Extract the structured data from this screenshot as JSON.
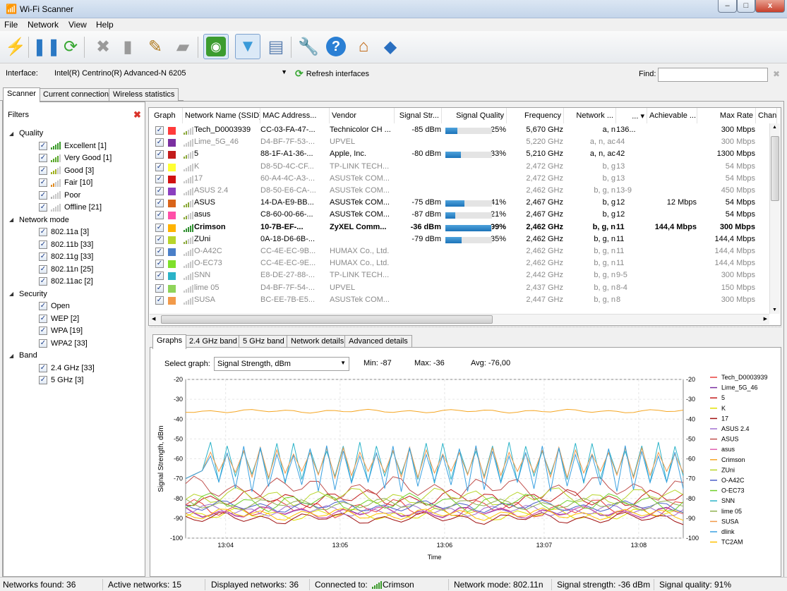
{
  "window": {
    "title": "Wi-Fi Scanner",
    "minimize": "–",
    "maximize": "□",
    "close": "x"
  },
  "menu": [
    "File",
    "Network",
    "View",
    "Help"
  ],
  "toolbar": [
    {
      "name": "start-stop-icon",
      "glyph": "⚡",
      "color": "#e8a400"
    },
    {
      "name": "pause-icon",
      "glyph": "❚❚",
      "color": "#2a78c4"
    },
    {
      "name": "refresh-icon",
      "glyph": "⟳",
      "color": "#3aa835"
    },
    {
      "name": "delete-icon",
      "glyph": "✖",
      "color": "#9a9a9a"
    },
    {
      "name": "remove-offline-icon",
      "glyph": "▮",
      "color": "#9a9a9a"
    },
    {
      "name": "clear-icon",
      "glyph": "✎",
      "color": "#b07a20"
    },
    {
      "name": "export-icon",
      "glyph": "▰",
      "color": "#9a9a9a"
    },
    {
      "name": "wifi-monitor-icon",
      "glyph": "◉",
      "color": "#2e8b2e"
    },
    {
      "name": "filter-icon",
      "glyph": "▼",
      "color": "#3a9ad9"
    },
    {
      "name": "report-icon",
      "glyph": "▤",
      "color": "#5a7fb0"
    },
    {
      "name": "settings-wrench-icon",
      "glyph": "🔧",
      "color": "#e28a1d"
    },
    {
      "name": "help-icon",
      "glyph": "?",
      "color": "#fff"
    },
    {
      "name": "home-icon",
      "glyph": "⌂",
      "color": "#c26c1a"
    },
    {
      "name": "about-icon",
      "glyph": "◆",
      "color": "#2a6fc0"
    }
  ],
  "interface": {
    "label": "Interface:",
    "value": "Intel(R) Centrino(R) Advanced-N 6205",
    "refresh": "Refresh interfaces",
    "find_label": "Find:",
    "find_value": ""
  },
  "main_tabs": [
    "Scanner",
    "Current connection",
    "Wireless statistics"
  ],
  "filters": {
    "title": "Filters",
    "groups": [
      {
        "label": "Quality",
        "items": [
          "Excellent [1]",
          "Very Good [1]",
          "Good [3]",
          "Fair [10]",
          "Poor",
          "Offline [21]"
        ]
      },
      {
        "label": "Network mode",
        "items": [
          "802.11a [3]",
          "802.11b [33]",
          "802.11g [33]",
          "802.11n [25]",
          "802.11ac [2]"
        ]
      },
      {
        "label": "Security",
        "items": [
          "Open",
          "WEP [2]",
          "WPA [19]",
          "WPA2 [33]"
        ]
      },
      {
        "label": "Band",
        "items": [
          "2.4 GHz [33]",
          "5 GHz [3]"
        ]
      }
    ]
  },
  "table": {
    "headers": [
      "Graph",
      "Network Name (SSID)",
      "MAC Address...",
      "Vendor",
      "Signal Str...",
      "Signal Quality",
      "Frequency",
      "Network ...",
      "... ▾",
      "Achievable ...",
      "Max Rate",
      "Chanr"
    ],
    "rows": [
      {
        "color": "#ff3b3b",
        "ssid": "Tech_D0003939",
        "mac": "CC-03-FA-47-...",
        "vendor": "Technicolor CH ...",
        "signal": "-85 dBm",
        "quality": "25%",
        "qv": 0.25,
        "freq": "5,670 GHz",
        "mode": "a, n",
        "ch": "136...",
        "ach": "",
        "max": "300 Mbps",
        "state": "on"
      },
      {
        "color": "#7a2fa0",
        "ssid": "Lime_5G_46",
        "mac": "D4-BF-7F-53-...",
        "vendor": "UPVEL",
        "signal": "",
        "quality": "",
        "qv": 0,
        "freq": "5,220 GHz",
        "mode": "a, n, ac",
        "ch": "44",
        "ach": "",
        "max": "300 Mbps",
        "state": "off"
      },
      {
        "color": "#c21b1b",
        "ssid": "5",
        "mac": "88-1F-A1-36-...",
        "vendor": "Apple, Inc.",
        "signal": "-80 dBm",
        "quality": "33%",
        "qv": 0.33,
        "freq": "5,210 GHz",
        "mode": "a, n, ac",
        "ch": "42",
        "ach": "",
        "max": "1300 Mbps",
        "state": "on"
      },
      {
        "color": "#ffff33",
        "ssid": "K",
        "mac": "D8-5D-4C-CF...",
        "vendor": "TP-LINK TECH...",
        "signal": "",
        "quality": "",
        "qv": 0,
        "freq": "2,472 GHz",
        "mode": "b, g",
        "ch": "13",
        "ach": "",
        "max": "54 Mbps",
        "state": "off"
      },
      {
        "color": "#d11111",
        "ssid": "17",
        "mac": "60-A4-4C-A3-...",
        "vendor": "ASUSTek COM...",
        "signal": "",
        "quality": "",
        "qv": 0,
        "freq": "2,472 GHz",
        "mode": "b, g",
        "ch": "13",
        "ach": "",
        "max": "54 Mbps",
        "state": "off"
      },
      {
        "color": "#8b3fc0",
        "ssid": "ASUS 2.4",
        "mac": "D8-50-E6-CA-...",
        "vendor": "ASUSTek COM...",
        "signal": "",
        "quality": "",
        "qv": 0,
        "freq": "2,462 GHz",
        "mode": "b, g, n",
        "ch": "13-9",
        "ach": "",
        "max": "450 Mbps",
        "state": "off"
      },
      {
        "color": "#d9641a",
        "ssid": "ASUS",
        "mac": "14-DA-E9-BB...",
        "vendor": "ASUSTek COM...",
        "signal": "-75 dBm",
        "quality": "41%",
        "qv": 0.41,
        "freq": "2,467 GHz",
        "mode": "b, g",
        "ch": "12",
        "ach": "12 Mbps",
        "max": "54 Mbps",
        "state": "on"
      },
      {
        "color": "#ff4fa8",
        "ssid": "asus",
        "mac": "C8-60-00-66-...",
        "vendor": "ASUSTek COM...",
        "signal": "-87 dBm",
        "quality": "21%",
        "qv": 0.21,
        "freq": "2,467 GHz",
        "mode": "b, g",
        "ch": "12",
        "ach": "",
        "max": "54 Mbps",
        "state": "on"
      },
      {
        "color": "#ffb300",
        "ssid": "Crimson",
        "mac": "10-7B-EF-...",
        "vendor": "ZyXEL Comm...",
        "signal": "-36 dBm",
        "quality": "99%",
        "qv": 0.99,
        "freq": "2,462 GHz",
        "mode": "b, g, n",
        "ch": "11",
        "ach": "144,4 Mbps",
        "max": "300 Mbps",
        "state": "bold"
      },
      {
        "color": "#b8d52a",
        "ssid": "ZUni",
        "mac": "0A-18-D6-6B-...",
        "vendor": "",
        "signal": "-79 dBm",
        "quality": "35%",
        "qv": 0.35,
        "freq": "2,462 GHz",
        "mode": "b, g, n",
        "ch": "11",
        "ach": "",
        "max": "144,4 Mbps",
        "state": "on"
      },
      {
        "color": "#4a7fc8",
        "ssid": "O-A42C",
        "mac": "CC-4E-EC-9B...",
        "vendor": "HUMAX Co., Ltd.",
        "signal": "",
        "quality": "",
        "qv": 0,
        "freq": "2,462 GHz",
        "mode": "b, g, n",
        "ch": "11",
        "ach": "",
        "max": "144,4 Mbps",
        "state": "off"
      },
      {
        "color": "#7ee02a",
        "ssid": "O-EC73",
        "mac": "CC-4E-EC-9E...",
        "vendor": "HUMAX Co., Ltd.",
        "signal": "",
        "quality": "",
        "qv": 0,
        "freq": "2,462 GHz",
        "mode": "b, g, n",
        "ch": "11",
        "ach": "",
        "max": "144,4 Mbps",
        "state": "off"
      },
      {
        "color": "#2bb3c8",
        "ssid": "SNN",
        "mac": "E8-DE-27-88-...",
        "vendor": "TP-LINK TECH...",
        "signal": "",
        "quality": "",
        "qv": 0,
        "freq": "2,442 GHz",
        "mode": "b, g, n",
        "ch": "9-5",
        "ach": "",
        "max": "300 Mbps",
        "state": "off"
      },
      {
        "color": "#8fd45a",
        "ssid": "lime 05",
        "mac": "D4-BF-7F-54-...",
        "vendor": "UPVEL",
        "signal": "",
        "quality": "",
        "qv": 0,
        "freq": "2,437 GHz",
        "mode": "b, g, n",
        "ch": "8-4",
        "ach": "",
        "max": "150 Mbps",
        "state": "off"
      },
      {
        "color": "#f29a4a",
        "ssid": "SUSA",
        "mac": "BC-EE-7B-E5...",
        "vendor": "ASUSTek COM...",
        "signal": "",
        "quality": "",
        "qv": 0,
        "freq": "2,447 GHz",
        "mode": "b, g, n",
        "ch": "8",
        "ach": "",
        "max": "300 Mbps",
        "state": "off"
      }
    ]
  },
  "bottom_tabs": [
    "Graphs",
    "2.4 GHz band",
    "5 GHz band",
    "Network details",
    "Advanced details"
  ],
  "graph": {
    "select_label": "Select graph:",
    "select_value": "Signal Strength, dBm",
    "min": "Min:  -87",
    "max": "Max:  -36",
    "avg": "Avg:  -76,00"
  },
  "chart_data": {
    "type": "line",
    "xlabel": "Time",
    "ylabel": "Signal Strength, dBm",
    "ylim": [
      -100,
      -20
    ],
    "yticks": [
      "-20",
      "-30",
      "-40",
      "-50",
      "-60",
      "-70",
      "-80",
      "-90",
      "-100"
    ],
    "xticks": [
      "13:04",
      "13:05",
      "13:06",
      "13:07",
      "13:08"
    ],
    "legend_position": "right",
    "series": [
      {
        "name": "Tech_D0003939",
        "color": "#e8403c",
        "base": -85,
        "amp": 3
      },
      {
        "name": "Lime_5G_46",
        "color": "#7a2fa0",
        "base": -87,
        "amp": 2
      },
      {
        "name": "5",
        "color": "#c21b1b",
        "base": -80,
        "amp": 3
      },
      {
        "name": "K",
        "color": "#e0e000",
        "base": -88,
        "amp": 2
      },
      {
        "name": "17",
        "color": "#a01010",
        "base": -90,
        "amp": 2
      },
      {
        "name": "ASUS 2.4",
        "color": "#a070d0",
        "base": -86,
        "amp": 2
      },
      {
        "name": "ASUS",
        "color": "#c0504d",
        "base": -75,
        "amp": 4
      },
      {
        "name": "asus",
        "color": "#e060b0",
        "base": -87,
        "amp": 2
      },
      {
        "name": "Crimson",
        "color": "#f5a623",
        "base": -36,
        "amp": 0.6
      },
      {
        "name": "ZUni",
        "color": "#b8d52a",
        "base": -79,
        "amp": 3
      },
      {
        "name": "O-A42C",
        "color": "#4a5fc8",
        "base": -84,
        "amp": 2
      },
      {
        "name": "O-EC73",
        "color": "#6fd02a",
        "base": -82,
        "amp": 3
      },
      {
        "name": "SNN",
        "color": "#2bb3c8",
        "base": -62,
        "amp": 8
      },
      {
        "name": "lime 05",
        "color": "#8fb050",
        "base": -83,
        "amp": 2
      },
      {
        "name": "SUSA",
        "color": "#f29a4a",
        "base": -62,
        "amp": 6
      },
      {
        "name": "dlink",
        "color": "#3aa0e0",
        "base": -65,
        "amp": 9
      },
      {
        "name": "TC2AM",
        "color": "#ffc000",
        "base": -88,
        "amp": 2
      }
    ]
  },
  "status": {
    "found": "Networks found: 36",
    "active": "Active networks: 15",
    "displayed": "Displayed networks: 36",
    "connected_label": "Connected to:",
    "connected_value": "Crimson",
    "mode": "Network mode: 802.11n",
    "strength": "Signal strength: -36 dBm",
    "quality": "Signal quality: 91%"
  }
}
